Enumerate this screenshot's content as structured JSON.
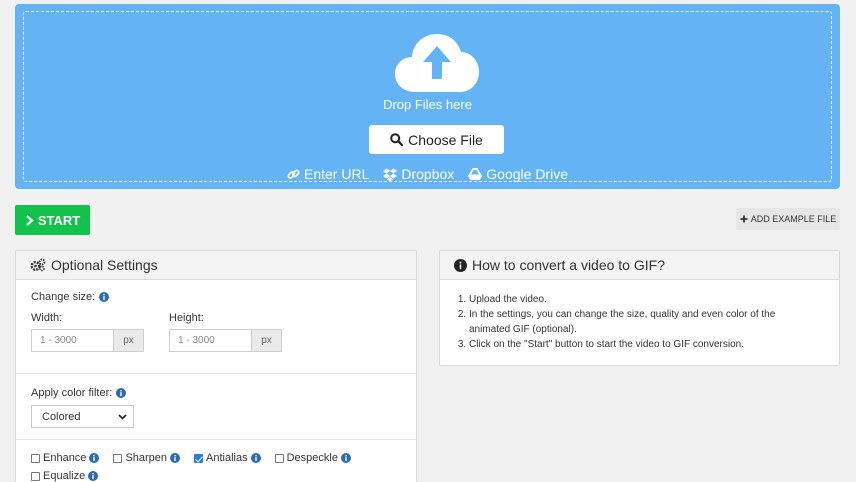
{
  "upload": {
    "drop_text": "Drop Files here",
    "choose_label": "Choose File",
    "sources": [
      {
        "label": "Enter URL",
        "icon": "link-icon"
      },
      {
        "label": "Dropbox",
        "icon": "dropbox-icon"
      },
      {
        "label": "Google Drive",
        "icon": "google-drive-icon"
      }
    ]
  },
  "actions": {
    "start_label": "START",
    "example_label": "ADD EXAMPLE FILE"
  },
  "settings": {
    "title": "Optional Settings",
    "change_size_label": "Change size:",
    "width_label": "Width:",
    "height_label": "Height:",
    "size_placeholder": "1 - 3000",
    "unit": "px",
    "color_filter_label": "Apply color filter:",
    "color_filter_value": "Colored",
    "checkboxes": [
      {
        "label": "Enhance",
        "checked": false
      },
      {
        "label": "Sharpen",
        "checked": false
      },
      {
        "label": "Antialias",
        "checked": true
      },
      {
        "label": "Despeckle",
        "checked": false
      },
      {
        "label": "Equalize",
        "checked": false
      }
    ]
  },
  "howto": {
    "title": "How to convert a video to GIF?",
    "steps": [
      "Upload the video.",
      "In the settings, you can change the size, quality and even color of the animated GIF (optional).",
      "Click on the \"Start\" button to start the video to GIF conversion."
    ]
  },
  "colors": {
    "dropzone": "#63b3f5",
    "start": "#12c24a",
    "info": "#2b6cb0"
  }
}
